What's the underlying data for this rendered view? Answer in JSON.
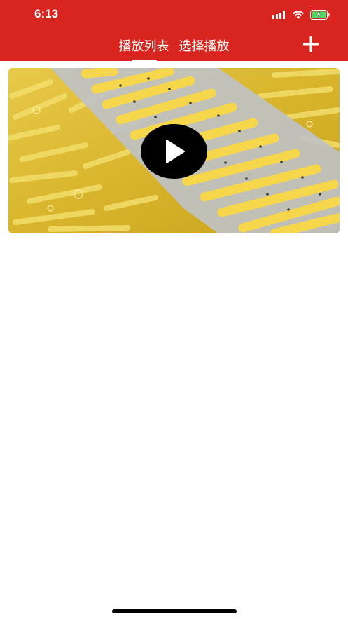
{
  "status_bar": {
    "time": "6:13",
    "icons": [
      "cellular-signal-icon",
      "wifi-icon",
      "battery-charging-icon"
    ]
  },
  "header": {
    "background": "#d9251f",
    "tabs": [
      {
        "label": "播放列表",
        "active": true
      },
      {
        "label": "选择播放",
        "active": false
      }
    ],
    "add_icon": "plus-icon"
  },
  "video_list": [
    {
      "thumbnail": "video-thumbnail-fries",
      "play_icon": "play-icon"
    }
  ]
}
